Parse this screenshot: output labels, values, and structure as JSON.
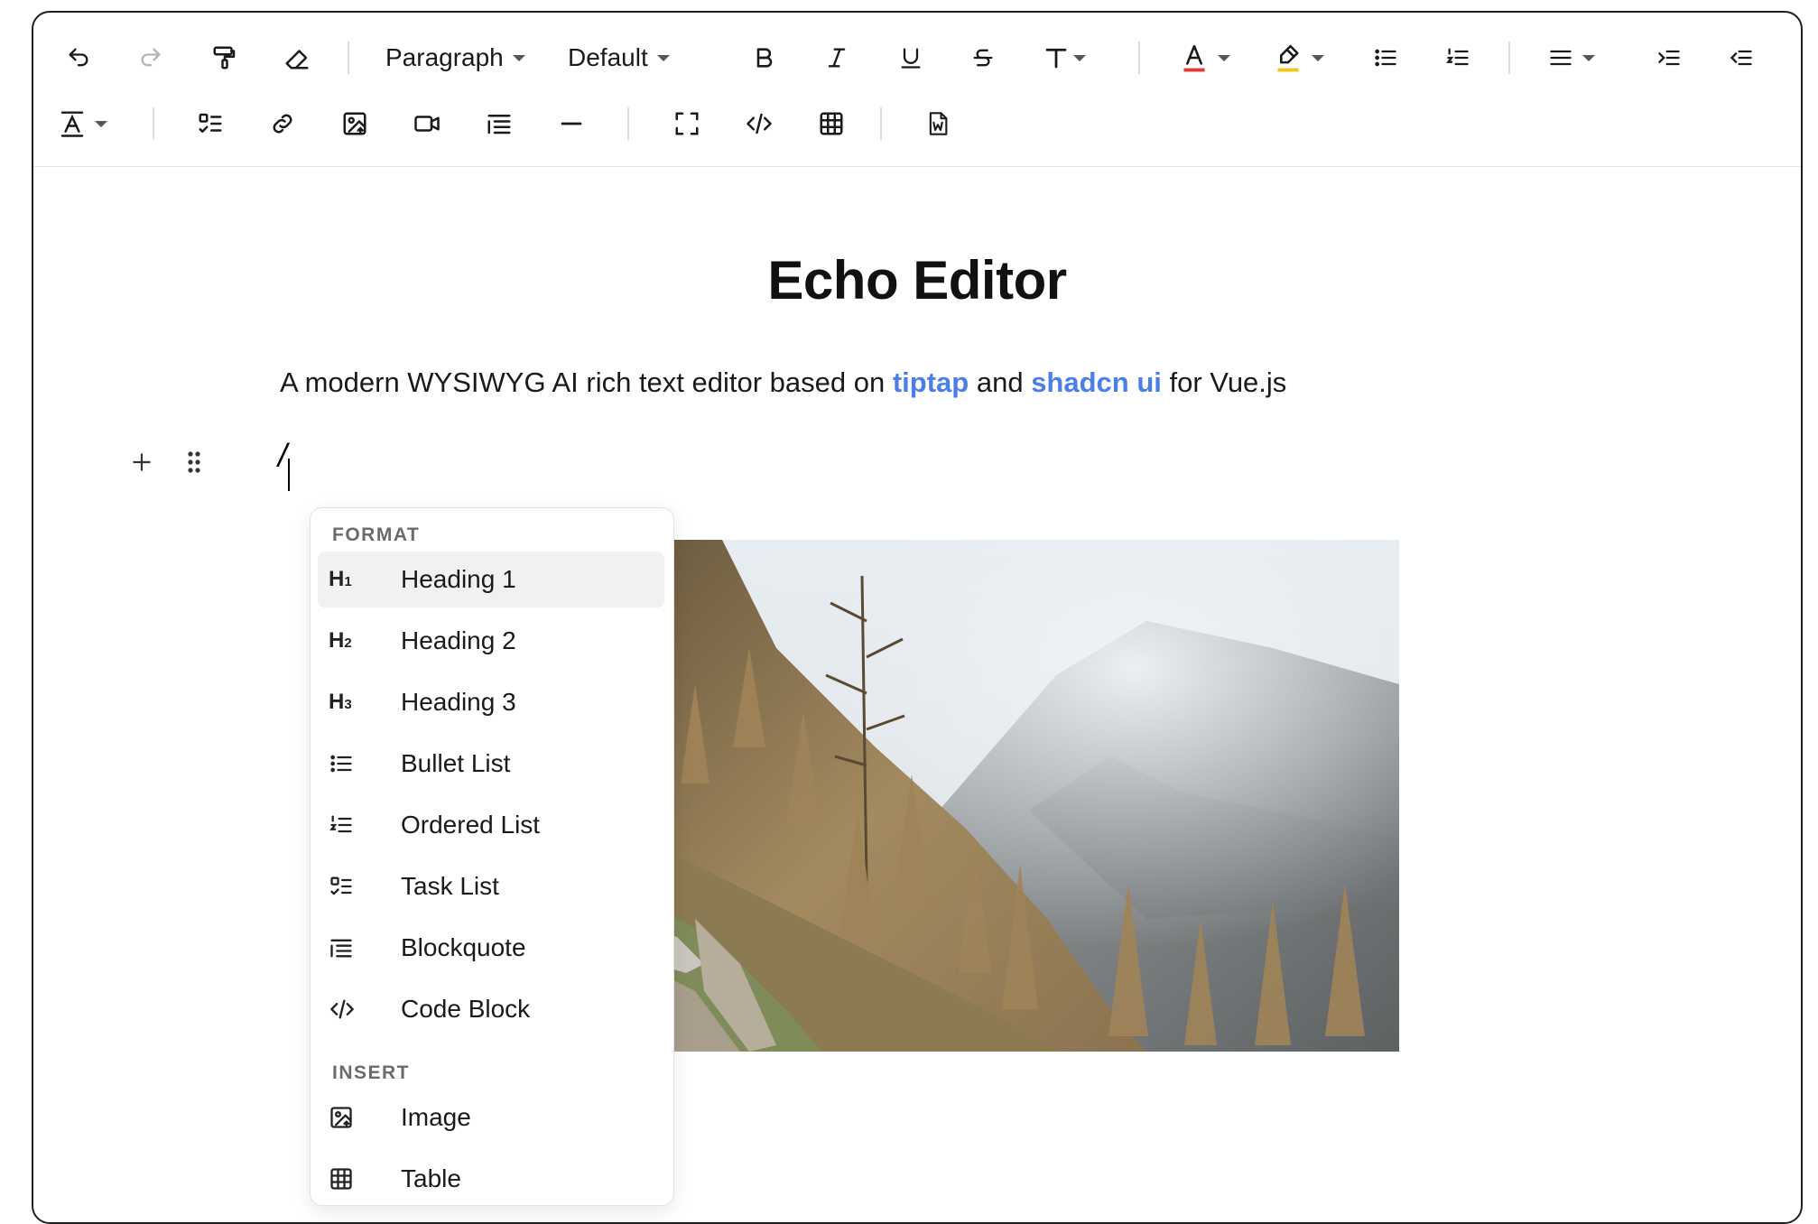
{
  "toolbar": {
    "paragraph_select": "Paragraph",
    "font_select": "Default",
    "text_color_accent": "#e53935",
    "highlight_accent": "#f5c518"
  },
  "editor": {
    "title": "Echo Editor",
    "subtitle": {
      "before": "A modern WYSIWYG AI rich text editor based on ",
      "link1": "tiptap",
      "middle": " and ",
      "link2": "shadcn ui",
      "after": " for Vue.js"
    },
    "current_line": "/",
    "link_color": "#4a7fe8"
  },
  "slash_menu": {
    "format_label": "FORMAT",
    "insert_label": "INSERT",
    "format_items": [
      {
        "label": "Heading 1",
        "icon": "heading-1-icon"
      },
      {
        "label": "Heading 2",
        "icon": "heading-2-icon"
      },
      {
        "label": "Heading 3",
        "icon": "heading-3-icon"
      },
      {
        "label": "Bullet List",
        "icon": "bullet-list-icon"
      },
      {
        "label": "Ordered List",
        "icon": "ordered-list-icon"
      },
      {
        "label": "Task List",
        "icon": "task-list-icon"
      },
      {
        "label": "Blockquote",
        "icon": "blockquote-icon"
      },
      {
        "label": "Code Block",
        "icon": "code-block-icon"
      }
    ],
    "insert_items": [
      {
        "label": "Image",
        "icon": "image-icon"
      },
      {
        "label": "Table",
        "icon": "table-icon"
      }
    ]
  }
}
